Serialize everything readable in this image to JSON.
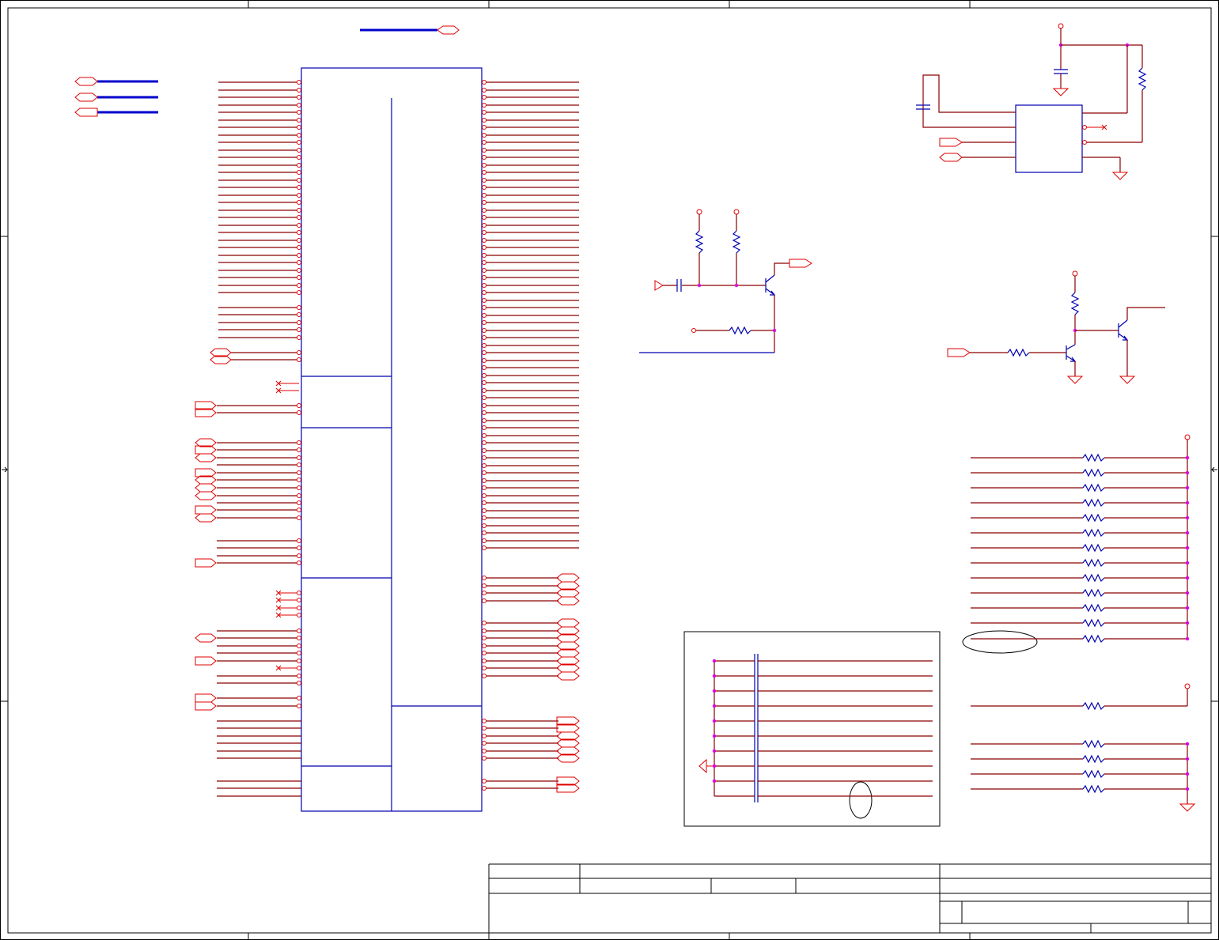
{
  "sheet": {
    "size": "",
    "title": "",
    "document_number": "",
    "revision": "",
    "date": "",
    "sheet_of": ""
  },
  "colors": {
    "wire": "#8b0000",
    "pin": "#e00000",
    "component": "#0000b0",
    "bus": "#0000cc",
    "junction": "#e000e0",
    "border": "#000000"
  },
  "blocks": [
    {
      "name": "main-ic",
      "label": ""
    },
    {
      "name": "eeprom-ic",
      "label": ""
    },
    {
      "name": "transistor-circuit-1",
      "label": ""
    },
    {
      "name": "transistor-circuit-2",
      "label": ""
    },
    {
      "name": "pullup-resistor-array",
      "label": ""
    },
    {
      "name": "capacitor-bank",
      "label": ""
    },
    {
      "name": "title-block",
      "label": ""
    }
  ]
}
